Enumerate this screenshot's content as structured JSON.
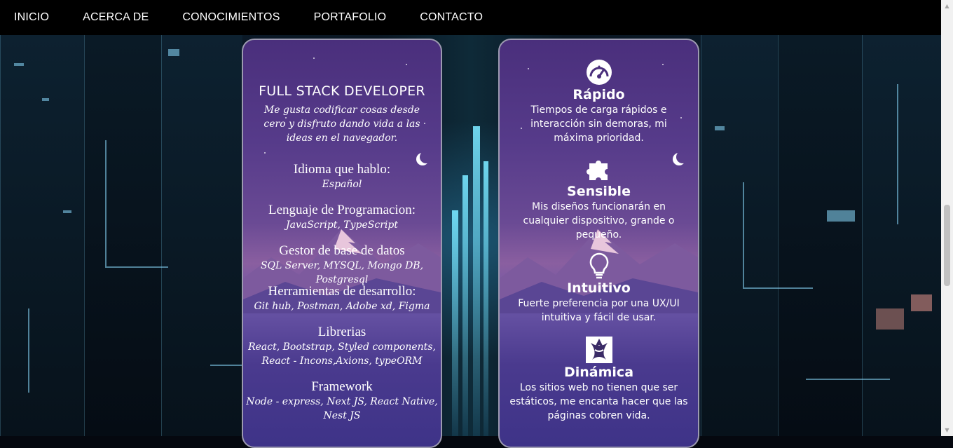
{
  "nav": {
    "items": [
      "INICIO",
      "ACERCA DE",
      "CONOCIMIENTOS",
      "PORTAFOLIO",
      "CONTACTO"
    ]
  },
  "left_card": {
    "title": "FULL STACK DEVELOPER",
    "description": "Me gusta codificar cosas desde cero y disfruto dando vida a las ideas en el navegador.",
    "items": [
      {
        "heading": "Idioma que hablo:",
        "value": "Español"
      },
      {
        "heading": "Lenguaje de Programacion:",
        "value": "JavaScript, TypeScript"
      },
      {
        "heading": "Gestor de base de datos",
        "value": "SQL Server, MYSQL, Mongo DB, Postgresql"
      },
      {
        "heading": "Herramientas de desarrollo:",
        "value": "Git hub, Postman, Adobe xd, Figma"
      },
      {
        "heading": "Librerias",
        "value": "React, Bootstrap, Styled components, React - Incons,Axions, typeORM"
      },
      {
        "heading": "Framework",
        "value": "Node - express, Next JS, React Native, Nest JS"
      }
    ]
  },
  "right_card": {
    "items": [
      {
        "icon": "speedometer-icon",
        "heading": "Rápido",
        "text": "Tiempos de carga rápidos e interacción sin demoras, mi máxima prioridad."
      },
      {
        "icon": "puzzle-icon",
        "heading": "Sensible",
        "text": "Mis diseños funcionarán en cualquier dispositivo, grande o pequeño."
      },
      {
        "icon": "lightbulb-icon",
        "heading": "Intuitivo",
        "text": "Fuerte preferencia por una UX/UI intuitiva y fácil de usar."
      },
      {
        "icon": "rocket-icon",
        "heading": "Dinámica",
        "text": "Los sitios web no tienen que ser estáticos, me encanta hacer que las páginas cobren vida."
      }
    ]
  },
  "colors": {
    "nav_bg": "#000000",
    "card_purple": "#4a2f7c",
    "card_border": "#9c9ab0"
  }
}
